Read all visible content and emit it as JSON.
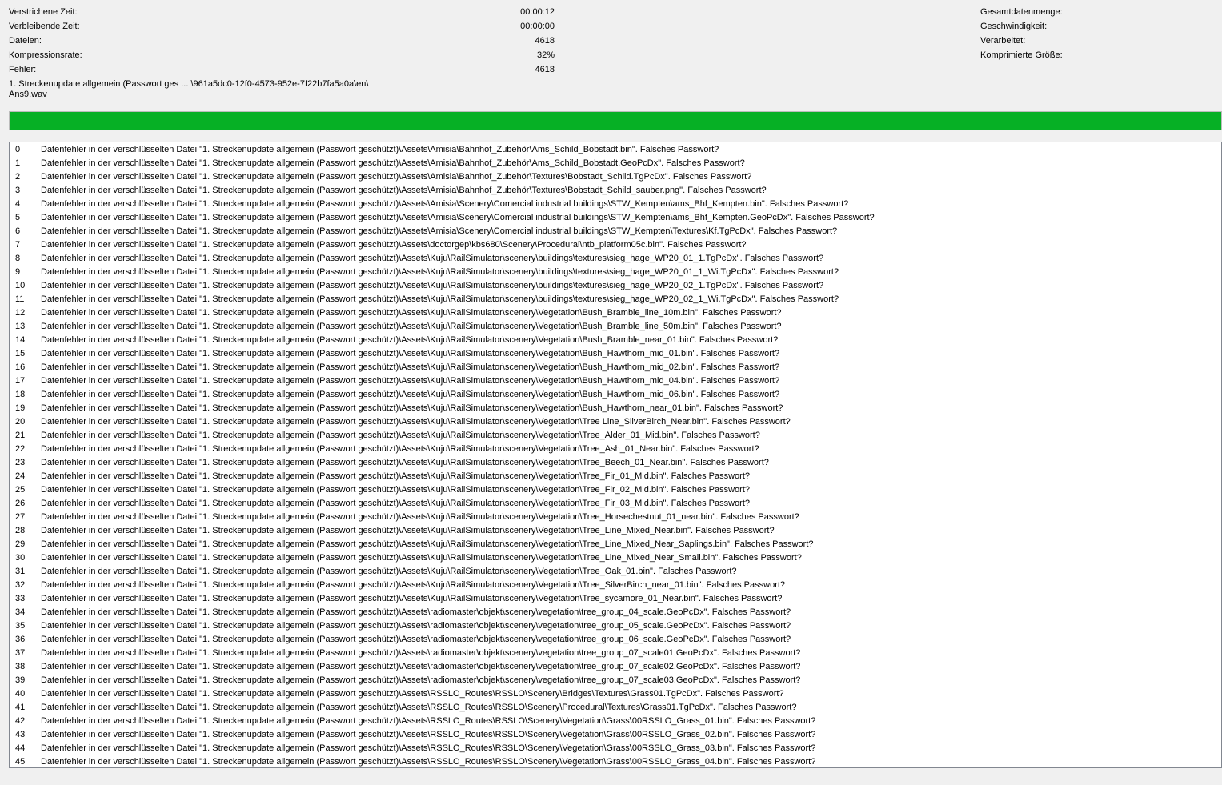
{
  "stats": {
    "elapsed_label": "Verstrichene Zeit:",
    "elapsed_value": "00:00:12",
    "remaining_label": "Verbleibende Zeit:",
    "remaining_value": "00:00:00",
    "files_label": "Dateien:",
    "files_value": "4618",
    "ratio_label": "Kompressionsrate:",
    "ratio_value": "32%",
    "errors_label": "Fehler:",
    "errors_value": "4618",
    "total_label": "Gesamtdatenmenge:",
    "speed_label": "Geschwindigkeit:",
    "processed_label": "Verarbeitet:",
    "compressed_label": "Komprimierte Größe:"
  },
  "current_file": {
    "line1": "1. Streckenupdate allgemein (Passwort ges ... \\961a5dc0-12f0-4573-952e-7f22b7fa5a0a\\en\\",
    "line2": "Ans9.wav"
  },
  "progress": {
    "percent": 100,
    "color": "#06b025"
  },
  "log": [
    {
      "idx": "0",
      "msg": "Datenfehler in der verschlüsselten Datei \"1. Streckenupdate allgemein (Passwort geschützt)\\Assets\\Amisia\\Bahnhof_Zubehör\\Ams_Schild_Bobstadt.bin\". Falsches Passwort?"
    },
    {
      "idx": "1",
      "msg": "Datenfehler in der verschlüsselten Datei \"1. Streckenupdate allgemein (Passwort geschützt)\\Assets\\Amisia\\Bahnhof_Zubehör\\Ams_Schild_Bobstadt.GeoPcDx\". Falsches Passwort?"
    },
    {
      "idx": "2",
      "msg": "Datenfehler in der verschlüsselten Datei \"1. Streckenupdate allgemein (Passwort geschützt)\\Assets\\Amisia\\Bahnhof_Zubehör\\Textures\\Bobstadt_Schild.TgPcDx\". Falsches Passwort?"
    },
    {
      "idx": "3",
      "msg": "Datenfehler in der verschlüsselten Datei \"1. Streckenupdate allgemein (Passwort geschützt)\\Assets\\Amisia\\Bahnhof_Zubehör\\Textures\\Bobstadt_Schild_sauber.png\". Falsches Passwort?"
    },
    {
      "idx": "4",
      "msg": "Datenfehler in der verschlüsselten Datei \"1. Streckenupdate allgemein (Passwort geschützt)\\Assets\\Amisia\\Scenery\\Comercial industrial buildings\\STW_Kempten\\ams_Bhf_Kempten.bin\". Falsches Passwort?"
    },
    {
      "idx": "5",
      "msg": "Datenfehler in der verschlüsselten Datei \"1. Streckenupdate allgemein (Passwort geschützt)\\Assets\\Amisia\\Scenery\\Comercial industrial buildings\\STW_Kempten\\ams_Bhf_Kempten.GeoPcDx\". Falsches Passwort?"
    },
    {
      "idx": "6",
      "msg": "Datenfehler in der verschlüsselten Datei \"1. Streckenupdate allgemein (Passwort geschützt)\\Assets\\Amisia\\Scenery\\Comercial industrial buildings\\STW_Kempten\\Textures\\Kf.TgPcDx\". Falsches Passwort?"
    },
    {
      "idx": "7",
      "msg": "Datenfehler in der verschlüsselten Datei \"1. Streckenupdate allgemein (Passwort geschützt)\\Assets\\doctorgep\\kbs680\\Scenery\\Procedural\\ntb_platform05c.bin\". Falsches Passwort?"
    },
    {
      "idx": "8",
      "msg": "Datenfehler in der verschlüsselten Datei \"1. Streckenupdate allgemein (Passwort geschützt)\\Assets\\Kuju\\RailSimulator\\scenery\\buildings\\textures\\sieg_hage_WP20_01_1.TgPcDx\". Falsches Passwort?"
    },
    {
      "idx": "9",
      "msg": "Datenfehler in der verschlüsselten Datei \"1. Streckenupdate allgemein (Passwort geschützt)\\Assets\\Kuju\\RailSimulator\\scenery\\buildings\\textures\\sieg_hage_WP20_01_1_Wi.TgPcDx\". Falsches Passwort?"
    },
    {
      "idx": "10",
      "msg": "Datenfehler in der verschlüsselten Datei \"1. Streckenupdate allgemein (Passwort geschützt)\\Assets\\Kuju\\RailSimulator\\scenery\\buildings\\textures\\sieg_hage_WP20_02_1.TgPcDx\". Falsches Passwort?"
    },
    {
      "idx": "11",
      "msg": "Datenfehler in der verschlüsselten Datei \"1. Streckenupdate allgemein (Passwort geschützt)\\Assets\\Kuju\\RailSimulator\\scenery\\buildings\\textures\\sieg_hage_WP20_02_1_Wi.TgPcDx\". Falsches Passwort?"
    },
    {
      "idx": "12",
      "msg": "Datenfehler in der verschlüsselten Datei \"1. Streckenupdate allgemein (Passwort geschützt)\\Assets\\Kuju\\RailSimulator\\scenery\\Vegetation\\Bush_Bramble_line_10m.bin\". Falsches Passwort?"
    },
    {
      "idx": "13",
      "msg": "Datenfehler in der verschlüsselten Datei \"1. Streckenupdate allgemein (Passwort geschützt)\\Assets\\Kuju\\RailSimulator\\scenery\\Vegetation\\Bush_Bramble_line_50m.bin\". Falsches Passwort?"
    },
    {
      "idx": "14",
      "msg": "Datenfehler in der verschlüsselten Datei \"1. Streckenupdate allgemein (Passwort geschützt)\\Assets\\Kuju\\RailSimulator\\scenery\\Vegetation\\Bush_Bramble_near_01.bin\". Falsches Passwort?"
    },
    {
      "idx": "15",
      "msg": "Datenfehler in der verschlüsselten Datei \"1. Streckenupdate allgemein (Passwort geschützt)\\Assets\\Kuju\\RailSimulator\\scenery\\Vegetation\\Bush_Hawthorn_mid_01.bin\". Falsches Passwort?"
    },
    {
      "idx": "16",
      "msg": "Datenfehler in der verschlüsselten Datei \"1. Streckenupdate allgemein (Passwort geschützt)\\Assets\\Kuju\\RailSimulator\\scenery\\Vegetation\\Bush_Hawthorn_mid_02.bin\". Falsches Passwort?"
    },
    {
      "idx": "17",
      "msg": "Datenfehler in der verschlüsselten Datei \"1. Streckenupdate allgemein (Passwort geschützt)\\Assets\\Kuju\\RailSimulator\\scenery\\Vegetation\\Bush_Hawthorn_mid_04.bin\". Falsches Passwort?"
    },
    {
      "idx": "18",
      "msg": "Datenfehler in der verschlüsselten Datei \"1. Streckenupdate allgemein (Passwort geschützt)\\Assets\\Kuju\\RailSimulator\\scenery\\Vegetation\\Bush_Hawthorn_mid_06.bin\". Falsches Passwort?"
    },
    {
      "idx": "19",
      "msg": "Datenfehler in der verschlüsselten Datei \"1. Streckenupdate allgemein (Passwort geschützt)\\Assets\\Kuju\\RailSimulator\\scenery\\Vegetation\\Bush_Hawthorn_near_01.bin\". Falsches Passwort?"
    },
    {
      "idx": "20",
      "msg": "Datenfehler in der verschlüsselten Datei \"1. Streckenupdate allgemein (Passwort geschützt)\\Assets\\Kuju\\RailSimulator\\scenery\\Vegetation\\Tree Line_SilverBirch_Near.bin\". Falsches Passwort?"
    },
    {
      "idx": "21",
      "msg": "Datenfehler in der verschlüsselten Datei \"1. Streckenupdate allgemein (Passwort geschützt)\\Assets\\Kuju\\RailSimulator\\scenery\\Vegetation\\Tree_Alder_01_Mid.bin\". Falsches Passwort?"
    },
    {
      "idx": "22",
      "msg": "Datenfehler in der verschlüsselten Datei \"1. Streckenupdate allgemein (Passwort geschützt)\\Assets\\Kuju\\RailSimulator\\scenery\\Vegetation\\Tree_Ash_01_Near.bin\". Falsches Passwort?"
    },
    {
      "idx": "23",
      "msg": "Datenfehler in der verschlüsselten Datei \"1. Streckenupdate allgemein (Passwort geschützt)\\Assets\\Kuju\\RailSimulator\\scenery\\Vegetation\\Tree_Beech_01_Near.bin\". Falsches Passwort?"
    },
    {
      "idx": "24",
      "msg": "Datenfehler in der verschlüsselten Datei \"1. Streckenupdate allgemein (Passwort geschützt)\\Assets\\Kuju\\RailSimulator\\scenery\\Vegetation\\Tree_Fir_01_Mid.bin\". Falsches Passwort?"
    },
    {
      "idx": "25",
      "msg": "Datenfehler in der verschlüsselten Datei \"1. Streckenupdate allgemein (Passwort geschützt)\\Assets\\Kuju\\RailSimulator\\scenery\\Vegetation\\Tree_Fir_02_Mid.bin\". Falsches Passwort?"
    },
    {
      "idx": "26",
      "msg": "Datenfehler in der verschlüsselten Datei \"1. Streckenupdate allgemein (Passwort geschützt)\\Assets\\Kuju\\RailSimulator\\scenery\\Vegetation\\Tree_Fir_03_Mid.bin\". Falsches Passwort?"
    },
    {
      "idx": "27",
      "msg": "Datenfehler in der verschlüsselten Datei \"1. Streckenupdate allgemein (Passwort geschützt)\\Assets\\Kuju\\RailSimulator\\scenery\\Vegetation\\Tree_Horsechestnut_01_near.bin\". Falsches Passwort?"
    },
    {
      "idx": "28",
      "msg": "Datenfehler in der verschlüsselten Datei \"1. Streckenupdate allgemein (Passwort geschützt)\\Assets\\Kuju\\RailSimulator\\scenery\\Vegetation\\Tree_Line_Mixed_Near.bin\". Falsches Passwort?"
    },
    {
      "idx": "29",
      "msg": "Datenfehler in der verschlüsselten Datei \"1. Streckenupdate allgemein (Passwort geschützt)\\Assets\\Kuju\\RailSimulator\\scenery\\Vegetation\\Tree_Line_Mixed_Near_Saplings.bin\". Falsches Passwort?"
    },
    {
      "idx": "30",
      "msg": "Datenfehler in der verschlüsselten Datei \"1. Streckenupdate allgemein (Passwort geschützt)\\Assets\\Kuju\\RailSimulator\\scenery\\Vegetation\\Tree_Line_Mixed_Near_Small.bin\". Falsches Passwort?"
    },
    {
      "idx": "31",
      "msg": "Datenfehler in der verschlüsselten Datei \"1. Streckenupdate allgemein (Passwort geschützt)\\Assets\\Kuju\\RailSimulator\\scenery\\Vegetation\\Tree_Oak_01.bin\". Falsches Passwort?"
    },
    {
      "idx": "32",
      "msg": "Datenfehler in der verschlüsselten Datei \"1. Streckenupdate allgemein (Passwort geschützt)\\Assets\\Kuju\\RailSimulator\\scenery\\Vegetation\\Tree_SilverBirch_near_01.bin\". Falsches Passwort?"
    },
    {
      "idx": "33",
      "msg": "Datenfehler in der verschlüsselten Datei \"1. Streckenupdate allgemein (Passwort geschützt)\\Assets\\Kuju\\RailSimulator\\scenery\\Vegetation\\Tree_sycamore_01_Near.bin\". Falsches Passwort?"
    },
    {
      "idx": "34",
      "msg": "Datenfehler in der verschlüsselten Datei \"1. Streckenupdate allgemein (Passwort geschützt)\\Assets\\radiomaster\\objekt\\scenery\\vegetation\\tree_group_04_scale.GeoPcDx\". Falsches Passwort?"
    },
    {
      "idx": "35",
      "msg": "Datenfehler in der verschlüsselten Datei \"1. Streckenupdate allgemein (Passwort geschützt)\\Assets\\radiomaster\\objekt\\scenery\\vegetation\\tree_group_05_scale.GeoPcDx\". Falsches Passwort?"
    },
    {
      "idx": "36",
      "msg": "Datenfehler in der verschlüsselten Datei \"1. Streckenupdate allgemein (Passwort geschützt)\\Assets\\radiomaster\\objekt\\scenery\\vegetation\\tree_group_06_scale.GeoPcDx\". Falsches Passwort?"
    },
    {
      "idx": "37",
      "msg": "Datenfehler in der verschlüsselten Datei \"1. Streckenupdate allgemein (Passwort geschützt)\\Assets\\radiomaster\\objekt\\scenery\\vegetation\\tree_group_07_scale01.GeoPcDx\". Falsches Passwort?"
    },
    {
      "idx": "38",
      "msg": "Datenfehler in der verschlüsselten Datei \"1. Streckenupdate allgemein (Passwort geschützt)\\Assets\\radiomaster\\objekt\\scenery\\vegetation\\tree_group_07_scale02.GeoPcDx\". Falsches Passwort?"
    },
    {
      "idx": "39",
      "msg": "Datenfehler in der verschlüsselten Datei \"1. Streckenupdate allgemein (Passwort geschützt)\\Assets\\radiomaster\\objekt\\scenery\\vegetation\\tree_group_07_scale03.GeoPcDx\". Falsches Passwort?"
    },
    {
      "idx": "40",
      "msg": "Datenfehler in der verschlüsselten Datei \"1. Streckenupdate allgemein (Passwort geschützt)\\Assets\\RSSLO_Routes\\RSSLO\\Scenery\\Bridges\\Textures\\Grass01.TgPcDx\". Falsches Passwort?"
    },
    {
      "idx": "41",
      "msg": "Datenfehler in der verschlüsselten Datei \"1. Streckenupdate allgemein (Passwort geschützt)\\Assets\\RSSLO_Routes\\RSSLO\\Scenery\\Procedural\\Textures\\Grass01.TgPcDx\". Falsches Passwort?"
    },
    {
      "idx": "42",
      "msg": "Datenfehler in der verschlüsselten Datei \"1. Streckenupdate allgemein (Passwort geschützt)\\Assets\\RSSLO_Routes\\RSSLO\\Scenery\\Vegetation\\Grass\\00RSSLO_Grass_01.bin\". Falsches Passwort?"
    },
    {
      "idx": "43",
      "msg": "Datenfehler in der verschlüsselten Datei \"1. Streckenupdate allgemein (Passwort geschützt)\\Assets\\RSSLO_Routes\\RSSLO\\Scenery\\Vegetation\\Grass\\00RSSLO_Grass_02.bin\". Falsches Passwort?"
    },
    {
      "idx": "44",
      "msg": "Datenfehler in der verschlüsselten Datei \"1. Streckenupdate allgemein (Passwort geschützt)\\Assets\\RSSLO_Routes\\RSSLO\\Scenery\\Vegetation\\Grass\\00RSSLO_Grass_03.bin\". Falsches Passwort?"
    },
    {
      "idx": "45",
      "msg": "Datenfehler in der verschlüsselten Datei \"1. Streckenupdate allgemein (Passwort geschützt)\\Assets\\RSSLO_Routes\\RSSLO\\Scenery\\Vegetation\\Grass\\00RSSLO_Grass_04.bin\". Falsches Passwort?"
    }
  ]
}
